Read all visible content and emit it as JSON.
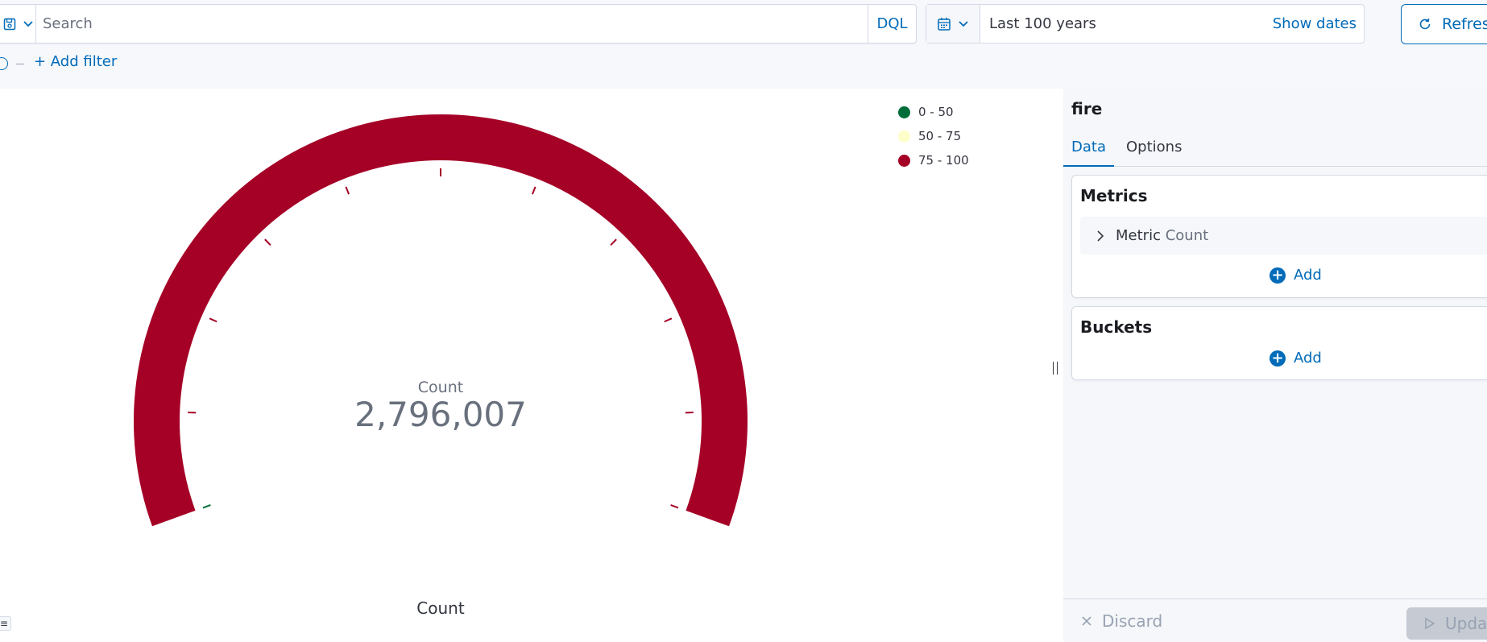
{
  "query": {
    "search_placeholder": "Search",
    "language": "DQL"
  },
  "time": {
    "range_label": "Last 100 years",
    "show_dates_label": "Show dates",
    "refresh_label": "Refresh"
  },
  "filters": {
    "add_filter_label": "+ Add filter"
  },
  "visualization": {
    "metric_label": "Count",
    "metric_value": "2,796,007",
    "axis_label": "Count",
    "legend": [
      {
        "label": "0 - 50",
        "color": "#006e3a"
      },
      {
        "label": "50 - 75",
        "color": "#fefecb"
      },
      {
        "label": "75 - 100",
        "color": "#a50026"
      }
    ],
    "gauge_color": "#a50026",
    "range_max": 100,
    "value_fraction": 1.0
  },
  "sidebar": {
    "index_pattern": "fire",
    "tabs": [
      {
        "label": "Data",
        "active": true
      },
      {
        "label": "Options",
        "active": false
      }
    ],
    "metrics": {
      "title": "Metrics",
      "items": [
        {
          "kind": "Metric",
          "name": "Count"
        }
      ],
      "add_label": "Add"
    },
    "buckets": {
      "title": "Buckets",
      "add_label": "Add"
    },
    "discard_label": "Discard",
    "update_label": "Update"
  }
}
